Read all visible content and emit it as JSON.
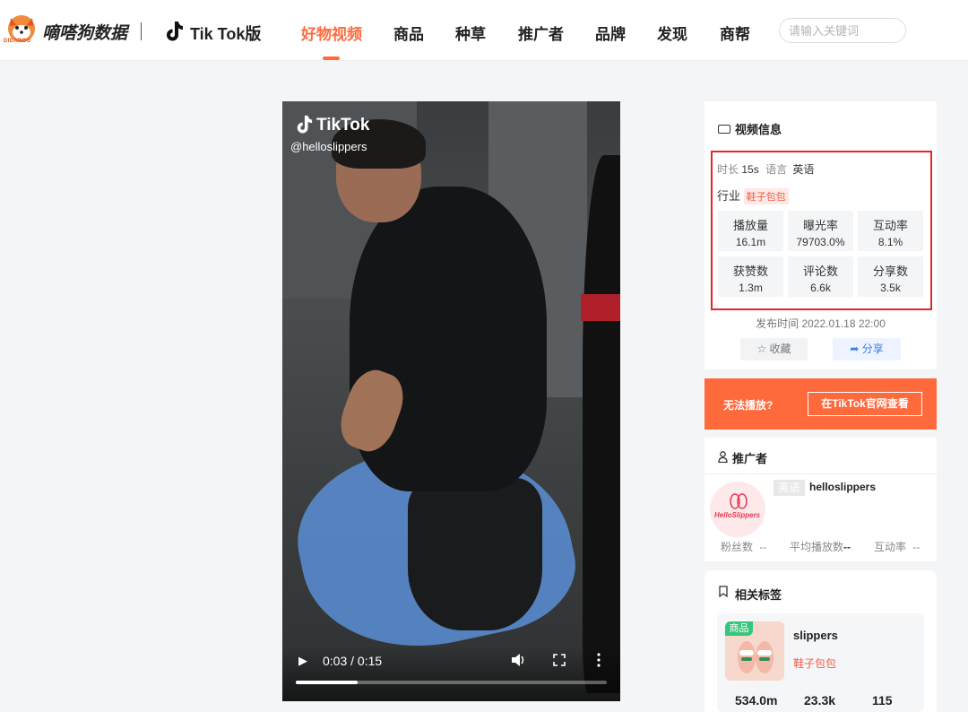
{
  "header": {
    "brand": "嘀嗒狗数据",
    "brand_sub": "DIDADOG",
    "tiktok_label": "Tik Tok版",
    "nav": [
      "好物视频",
      "商品",
      "种草",
      "推广者",
      "品牌",
      "发现",
      "商帮"
    ],
    "active_nav": "好物视频",
    "search_placeholder": "请输入关键词",
    "accent_color": "#ff6a3d"
  },
  "video": {
    "overlay_brand": "TikTok",
    "handle": "@helloslippers",
    "time": "0:03 / 0:15",
    "progress": 0.2
  },
  "video_info": {
    "title": "视频信息",
    "duration_label": "时长",
    "duration": "15s",
    "language_label": "语言",
    "language": "英语",
    "industry_label": "行业",
    "industry": "鞋子包包",
    "stats": [
      {
        "label": "播放量",
        "value": "16.1m"
      },
      {
        "label": "曝光率",
        "value": "79703.0%"
      },
      {
        "label": "互动率",
        "value": "8.1%"
      },
      {
        "label": "获赞数",
        "value": "1.3m"
      },
      {
        "label": "评论数",
        "value": "6.6k"
      },
      {
        "label": "分享数",
        "value": "3.5k"
      }
    ],
    "publish_time": "发布时间 2022.01.18 22:00",
    "favorite_label": "收藏",
    "share_label": "分享"
  },
  "cta": {
    "cannot_play": "无法播放?",
    "view_on_tiktok": "在TikTok官网查看"
  },
  "promoter": {
    "title": "推广者",
    "language_badge": "英语",
    "name": "helloslippers",
    "avatar_text": "HelloSlippers",
    "followers_label": "粉丝数",
    "followers_value": "--",
    "avg_plays_label": "平均播放数",
    "avg_plays_value": "--",
    "engagement_label": "互动率",
    "engagement_value": "--"
  },
  "related_tags": {
    "title": "相关标签",
    "product_badge": "商品",
    "product_name": "slippers",
    "product_category": "鞋子包包",
    "numbers": [
      "534.0m",
      "23.3k",
      "115"
    ]
  }
}
